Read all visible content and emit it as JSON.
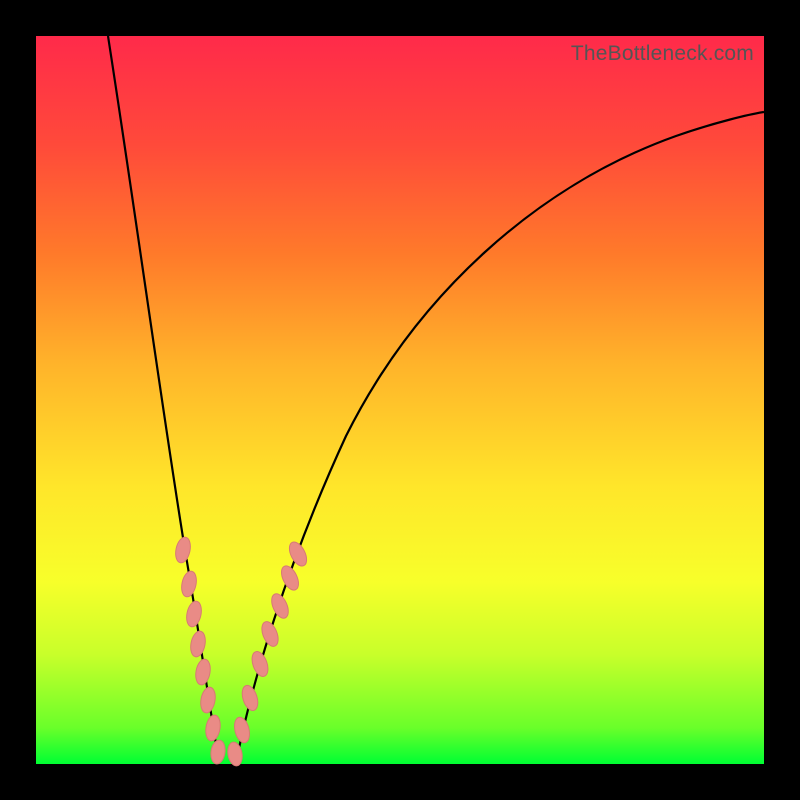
{
  "watermark": "TheBottleneck.com",
  "chart_data": {
    "type": "line",
    "title": "",
    "xlabel": "",
    "ylabel": "",
    "xlim": [
      0,
      100
    ],
    "ylim": [
      0,
      100
    ],
    "series": [
      {
        "name": "left-branch",
        "x": [
          10,
          13,
          15,
          17,
          19,
          20,
          21,
          22,
          23,
          24,
          25
        ],
        "values": [
          100,
          78,
          64,
          50,
          36,
          28,
          22,
          16,
          10,
          5,
          0
        ]
      },
      {
        "name": "right-branch",
        "x": [
          27,
          29,
          31,
          34,
          38,
          43,
          50,
          58,
          68,
          80,
          95,
          100
        ],
        "values": [
          0,
          8,
          15,
          24,
          34,
          44,
          55,
          64,
          72,
          80,
          86,
          88
        ]
      }
    ],
    "annotations": [
      {
        "name": "cluster-left",
        "kind": "pill-cluster",
        "branch": "left",
        "points": [
          {
            "x": 20.0,
            "y": 29
          },
          {
            "x": 20.8,
            "y": 24
          },
          {
            "x": 21.4,
            "y": 20
          },
          {
            "x": 22.0,
            "y": 16
          },
          {
            "x": 22.6,
            "y": 12
          },
          {
            "x": 23.3,
            "y": 8
          },
          {
            "x": 24.0,
            "y": 4
          },
          {
            "x": 24.8,
            "y": 1
          }
        ]
      },
      {
        "name": "cluster-right",
        "kind": "pill-cluster",
        "branch": "right",
        "points": [
          {
            "x": 27.0,
            "y": 1
          },
          {
            "x": 28.0,
            "y": 4
          },
          {
            "x": 29.2,
            "y": 9
          },
          {
            "x": 30.5,
            "y": 14
          },
          {
            "x": 31.8,
            "y": 18
          },
          {
            "x": 33.0,
            "y": 22
          },
          {
            "x": 34.5,
            "y": 26
          },
          {
            "x": 35.5,
            "y": 29
          }
        ]
      }
    ],
    "colors": {
      "curve": "#000000",
      "pill_fill": "#e98b86",
      "pill_stroke": "#d77a74"
    }
  }
}
